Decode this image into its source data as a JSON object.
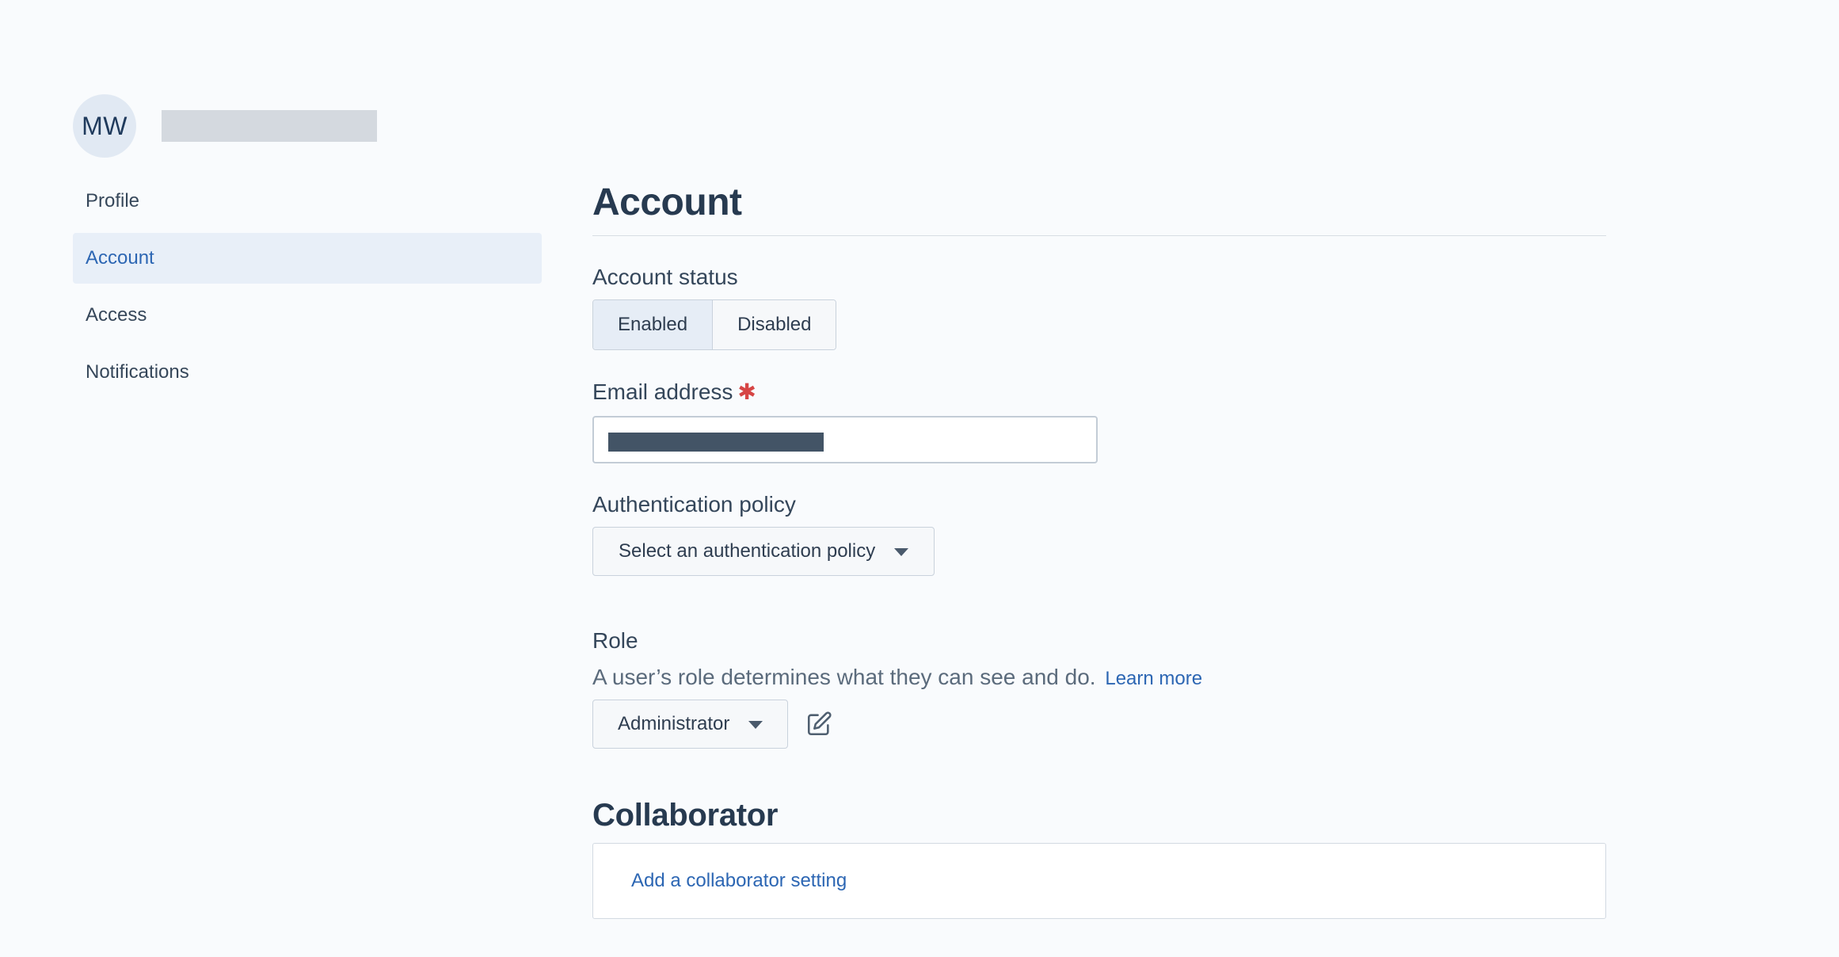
{
  "user": {
    "initials": "MW"
  },
  "sidebar": {
    "items": [
      {
        "label": "Profile",
        "active": false
      },
      {
        "label": "Account",
        "active": true
      },
      {
        "label": "Access",
        "active": false
      },
      {
        "label": "Notifications",
        "active": false
      }
    ]
  },
  "main": {
    "title": "Account",
    "account_status": {
      "label": "Account status",
      "options": [
        "Enabled",
        "Disabled"
      ],
      "selected": "Enabled"
    },
    "email": {
      "label": "Email address",
      "required_mark": "✱"
    },
    "auth_policy": {
      "label": "Authentication policy",
      "placeholder": "Select an authentication policy"
    },
    "role": {
      "label": "Role",
      "description": "A user’s role determines what they can see and do.",
      "learn_more": "Learn more",
      "value": "Administrator"
    },
    "collaborator": {
      "heading": "Collaborator",
      "add_link": "Add a collaborator setting"
    }
  },
  "icons": {
    "caret": "chevron-down-icon",
    "edit": "edit-icon"
  },
  "colors": {
    "accent": "#2c66b3",
    "required": "#d64545",
    "active_nav_bg": "#e8eff8"
  }
}
